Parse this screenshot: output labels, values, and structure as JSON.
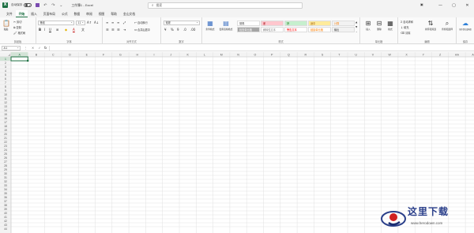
{
  "titlebar": {
    "autosave_label": "自动保存",
    "autosave_state": "关",
    "doc_title": "工作簿1 - Excel",
    "search_placeholder": "搜索",
    "minimize": "—",
    "maximize": "▢",
    "close": "✕"
  },
  "tabs": [
    "文件",
    "开始",
    "插入",
    "页面布局",
    "公式",
    "数据",
    "审阅",
    "视图",
    "帮助",
    "金山文档"
  ],
  "active_tab": 1,
  "ribbon": {
    "clipboard": {
      "label": "剪贴板",
      "paste": "粘贴",
      "cut": "剪切",
      "copy": "复制",
      "format_painter": "格式刷"
    },
    "font": {
      "label": "字体",
      "font_name": "等线",
      "font_size": "11",
      "bold": "B",
      "italic": "I",
      "underline": "U"
    },
    "alignment": {
      "label": "对齐方式",
      "wrap": "自动换行",
      "merge": "合并后居中"
    },
    "number": {
      "label": "数字",
      "format": "常规",
      "percent": "%",
      "comma": "9"
    },
    "styles": {
      "label": "样式",
      "conditional": "条件格式",
      "table": "套用表格格式",
      "cells": [
        {
          "name": "常规",
          "bg": "#ffffff",
          "color": "#333333"
        },
        {
          "name": "差",
          "bg": "#ffc7ce",
          "color": "#9c0006"
        },
        {
          "name": "好",
          "bg": "#c6efce",
          "color": "#006100"
        },
        {
          "name": "适中",
          "bg": "#ffeb9c",
          "color": "#9c5700"
        },
        {
          "name": "计算",
          "bg": "#f2f2f2",
          "color": "#fa7d00"
        },
        {
          "name": "检查单元格",
          "bg": "#a5a5a5",
          "color": "#ffffff"
        },
        {
          "name": "解释性文本",
          "bg": "#ffffff",
          "color": "#7f7f7f"
        },
        {
          "name": "警告文本",
          "bg": "#ffffff",
          "color": "#ff0000"
        },
        {
          "name": "链接单元格",
          "bg": "#ffffff",
          "color": "#fa7d00"
        },
        {
          "name": "输出",
          "bg": "#f2f2f2",
          "color": "#3f3f3f"
        }
      ]
    },
    "cells": {
      "label": "单元格",
      "insert": "插入",
      "delete": "删除",
      "format": "格式"
    },
    "editing": {
      "label": "编辑",
      "autosum": "自动求和",
      "fill": "填充",
      "clear": "清除",
      "sort": "排序和筛选",
      "find": "查找和选择"
    },
    "save": {
      "label": "保存",
      "button": "保存到百度网盘"
    }
  },
  "formula_bar": {
    "namebox": "A1",
    "fx": "fx",
    "content": ""
  },
  "sheet": {
    "columns": [
      "A",
      "B",
      "C",
      "D",
      "E",
      "F",
      "G",
      "H",
      "I",
      "J",
      "K",
      "L",
      "M",
      "N",
      "O",
      "P",
      "Q",
      "R",
      "S",
      "T",
      "U",
      "V",
      "W",
      "X",
      "Y",
      "Z",
      "AA",
      "AB"
    ],
    "row_count": 44,
    "selected_cell": "A1"
  },
  "watermark": {
    "title": "这里下载",
    "url": "www.herodown.com"
  }
}
